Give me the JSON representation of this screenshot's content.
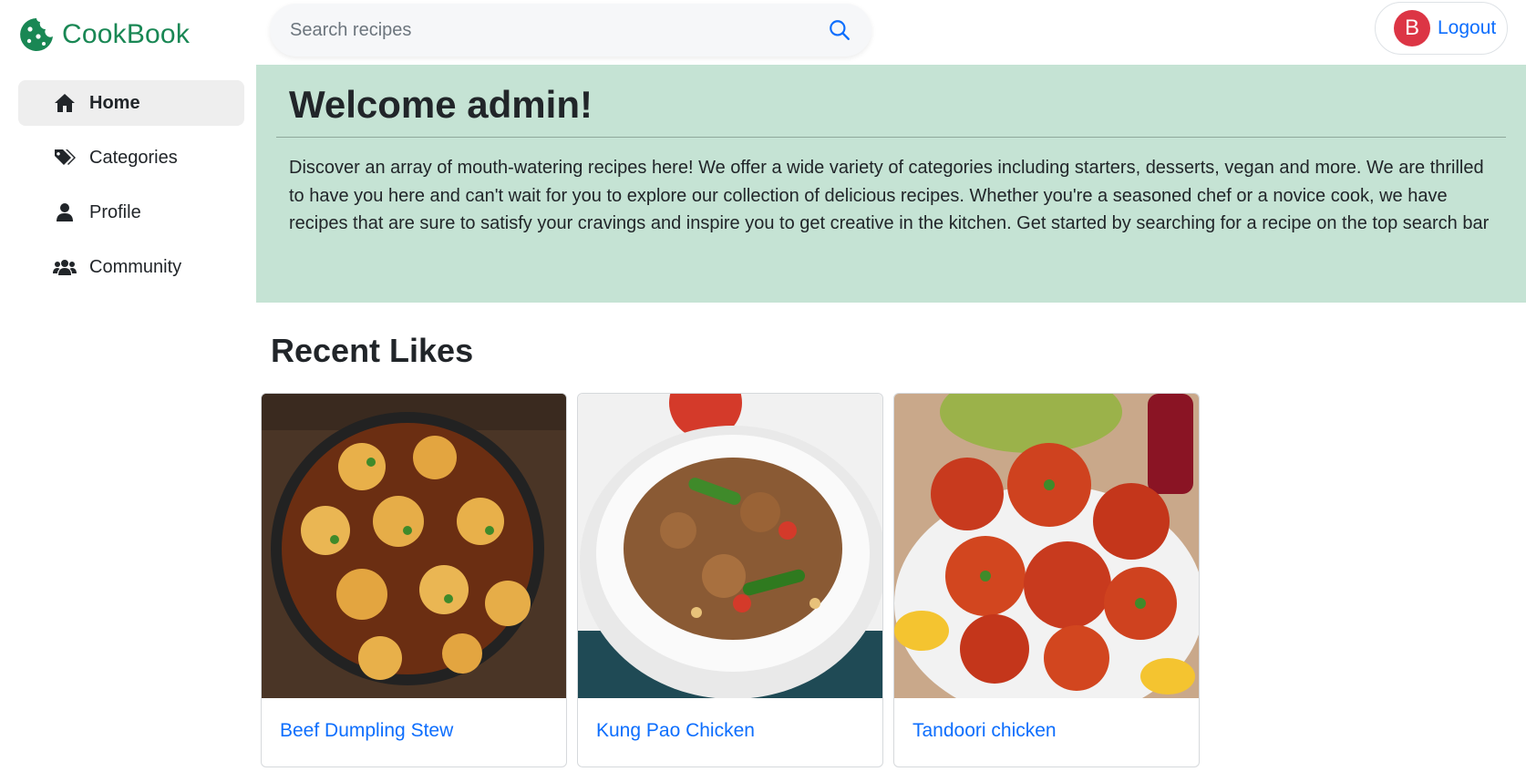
{
  "brand": {
    "name": "CookBook",
    "icon": "cookie-icon",
    "color": "#198754"
  },
  "search": {
    "placeholder": "Search recipes",
    "value": "",
    "icon": "search-icon"
  },
  "user": {
    "avatar_letter": "B",
    "logout_label": "Logout",
    "avatar_color": "#dc3545"
  },
  "sidebar": {
    "items": [
      {
        "label": "Home",
        "icon": "home-icon",
        "active": true
      },
      {
        "label": "Categories",
        "icon": "tags-icon",
        "active": false
      },
      {
        "label": "Profile",
        "icon": "user-icon",
        "active": false
      },
      {
        "label": "Community",
        "icon": "users-icon",
        "active": false
      }
    ]
  },
  "hero": {
    "title": "Welcome admin!",
    "text": "Discover an array of mouth-watering recipes here! We offer a wide variety of categories including starters, desserts, vegan and more. We are thrilled to have you here and can't wait for you to explore our collection of delicious recipes. Whether you're a seasoned chef or a novice cook, we have recipes that are sure to satisfy your cravings and inspire you to get creative in the kitchen. Get started by searching for a recipe on the top search bar",
    "background": "#c5e3d4"
  },
  "recent_likes": {
    "title": "Recent Likes",
    "cards": [
      {
        "title": "Beef Dumpling Stew"
      },
      {
        "title": "Kung Pao Chicken"
      },
      {
        "title": "Tandoori chicken"
      }
    ]
  },
  "colors": {
    "link": "#0d6efd"
  }
}
